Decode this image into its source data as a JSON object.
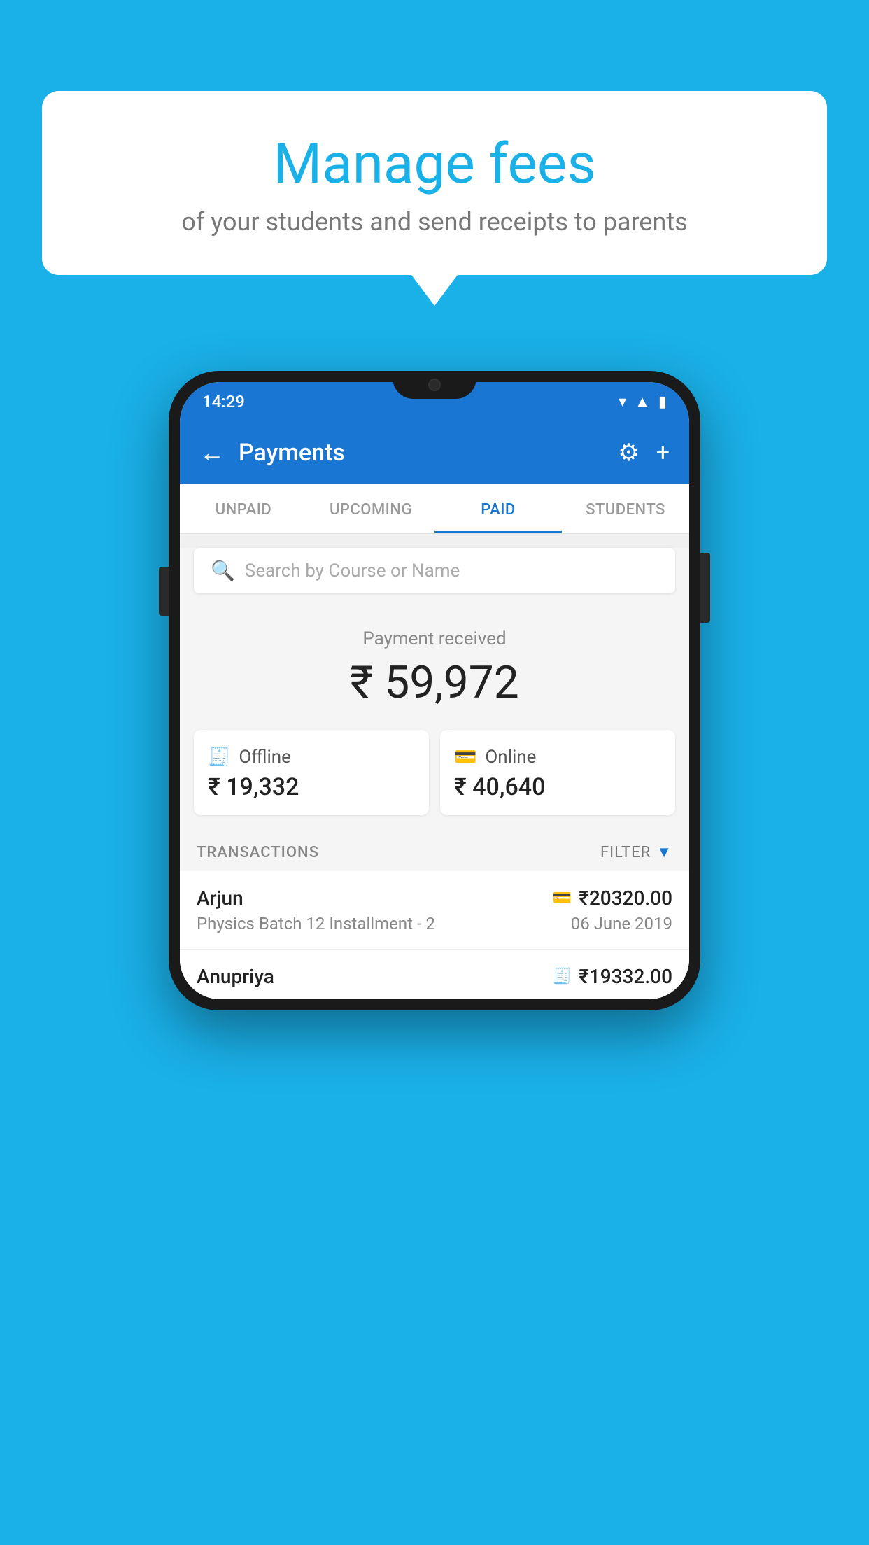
{
  "background_color": "#1AB0E8",
  "bubble": {
    "title": "Manage fees",
    "subtitle": "of your students and send receipts to parents"
  },
  "phone": {
    "status_bar": {
      "time": "14:29"
    },
    "app_bar": {
      "title": "Payments",
      "back_label": "←",
      "gear_label": "⚙",
      "plus_label": "+"
    },
    "tabs": [
      {
        "label": "UNPAID",
        "active": false
      },
      {
        "label": "UPCOMING",
        "active": false
      },
      {
        "label": "PAID",
        "active": true
      },
      {
        "label": "STUDENTS",
        "active": false
      }
    ],
    "search": {
      "placeholder": "Search by Course or Name"
    },
    "payment_summary": {
      "label": "Payment received",
      "amount": "₹ 59,972"
    },
    "payment_cards": [
      {
        "type": "Offline",
        "amount": "₹ 19,332",
        "icon": "offline"
      },
      {
        "type": "Online",
        "amount": "₹ 40,640",
        "icon": "online"
      }
    ],
    "transactions_section": {
      "label": "TRANSACTIONS",
      "filter_label": "FILTER"
    },
    "transactions": [
      {
        "name": "Arjun",
        "course": "Physics Batch 12 Installment - 2",
        "amount": "₹20320.00",
        "date": "06 June 2019",
        "icon": "online"
      },
      {
        "name": "Anupriya",
        "course": "",
        "amount": "₹19332.00",
        "date": "",
        "icon": "offline"
      }
    ]
  }
}
